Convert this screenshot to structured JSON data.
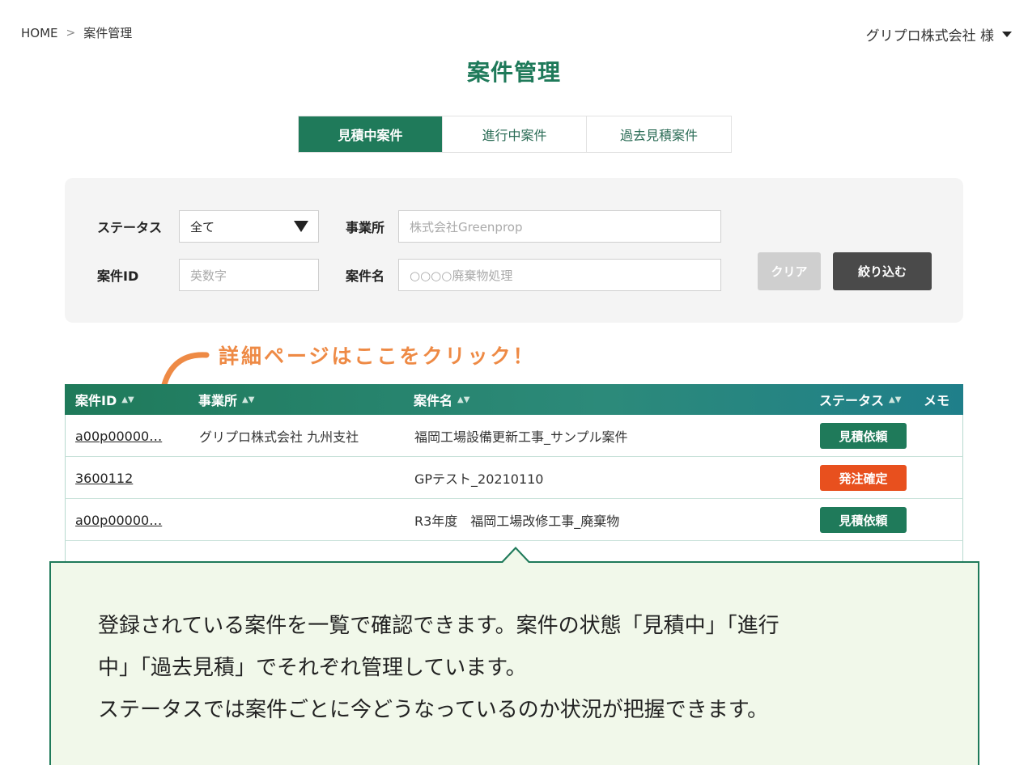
{
  "breadcrumb": {
    "home": "HOME",
    "separator": ">",
    "current": "案件管理"
  },
  "user": {
    "name": "グリプロ株式会社 様"
  },
  "title": "案件管理",
  "tabs": [
    {
      "label": "見積中案件",
      "active": true
    },
    {
      "label": "進行中案件",
      "active": false
    },
    {
      "label": "過去見積案件",
      "active": false
    }
  ],
  "filters": {
    "status_label": "ステータス",
    "status_value": "全て",
    "office_label": "事業所",
    "office_placeholder": "株式会社Greenprop",
    "case_id_label": "案件ID",
    "case_id_placeholder": "英数字",
    "case_name_label": "案件名",
    "case_name_placeholder": "○○○○廃棄物処理",
    "clear_button": "クリア",
    "filter_button": "絞り込む"
  },
  "callout": "詳細ページはここをクリック！",
  "table": {
    "columns": {
      "id": "案件ID",
      "office": "事業所",
      "name": "案件名",
      "status": "ステータス",
      "memo": "メモ"
    },
    "rows": [
      {
        "id": "a00p00000…",
        "office": "グリプロ株式会社 九州支社",
        "name": "福岡工場設備更新工事_サンプル案件",
        "status": "見積依頼",
        "status_color": "#1f7a5a"
      },
      {
        "id": "3600112",
        "office": "",
        "name": "GPテスト_20210110",
        "status": "発注確定",
        "status_color": "#e8501e"
      },
      {
        "id": "a00p00000…",
        "office": "",
        "name": "R3年度　福岡工場改修工事_廃棄物",
        "status": "見積依頼",
        "status_color": "#1f7a5a"
      }
    ]
  },
  "tooltip": {
    "line1": "登録されている案件を一覧で確認できます。案件の状態「見積中」「進行",
    "line2": "中」「過去見積」でそれぞれ管理しています。",
    "line3": "ステータスでは案件ごとに今どうなっているのか状況が把握できます。"
  },
  "colors": {
    "accent": "#1f7a5a",
    "callout": "#ee8a45",
    "tooltip_bg": "#f1f8ea"
  }
}
